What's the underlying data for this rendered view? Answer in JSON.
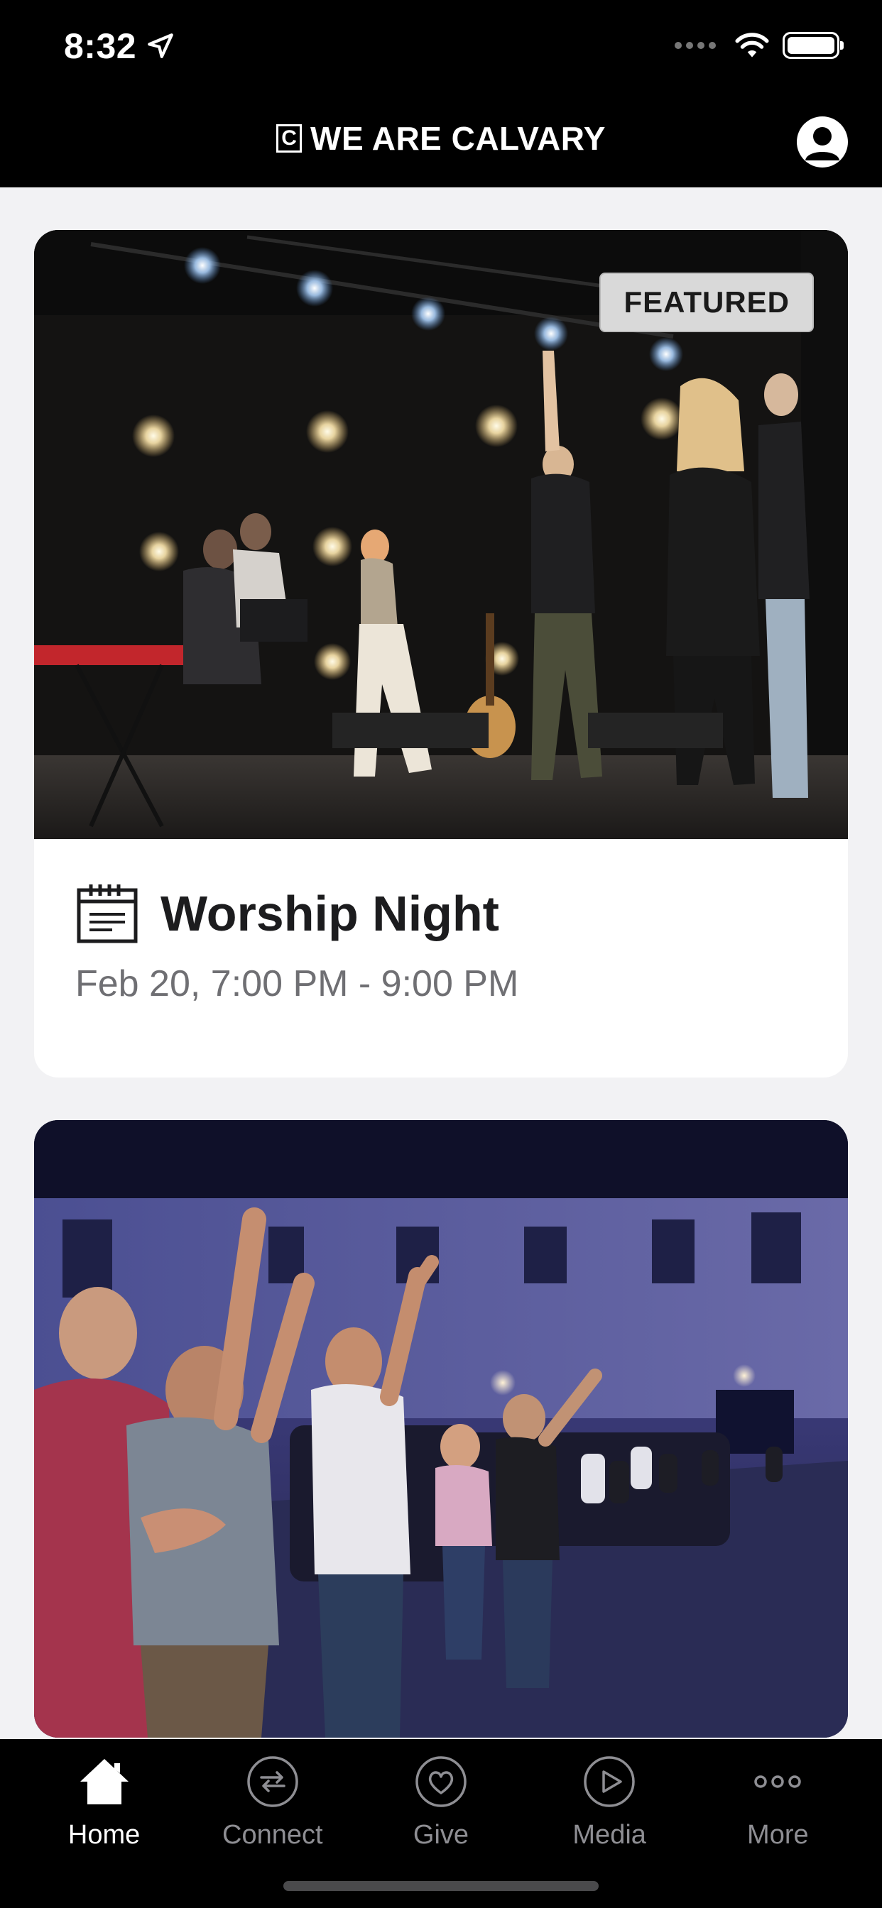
{
  "status_bar": {
    "time": "8:32"
  },
  "header": {
    "brand_mark": "C",
    "brand_name": "WE ARE CALVARY"
  },
  "feed": [
    {
      "badge": "FEATURED",
      "title": "Worship Night",
      "datetime": "Feb 20, 7:00 PM - 9:00 PM",
      "icon": "calendar-icon"
    },
    {
      "badge": "",
      "title": "",
      "datetime": ""
    }
  ],
  "tabbar": {
    "active": "Home",
    "items": [
      {
        "label": "Home",
        "icon": "home-icon"
      },
      {
        "label": "Connect",
        "icon": "connect-icon"
      },
      {
        "label": "Give",
        "icon": "give-icon"
      },
      {
        "label": "Media",
        "icon": "media-icon"
      },
      {
        "label": "More",
        "icon": "more-icon"
      }
    ]
  },
  "colors": {
    "header_bg": "#000000",
    "page_bg": "#f2f2f4",
    "inactive_tab": "#8e8e93"
  }
}
